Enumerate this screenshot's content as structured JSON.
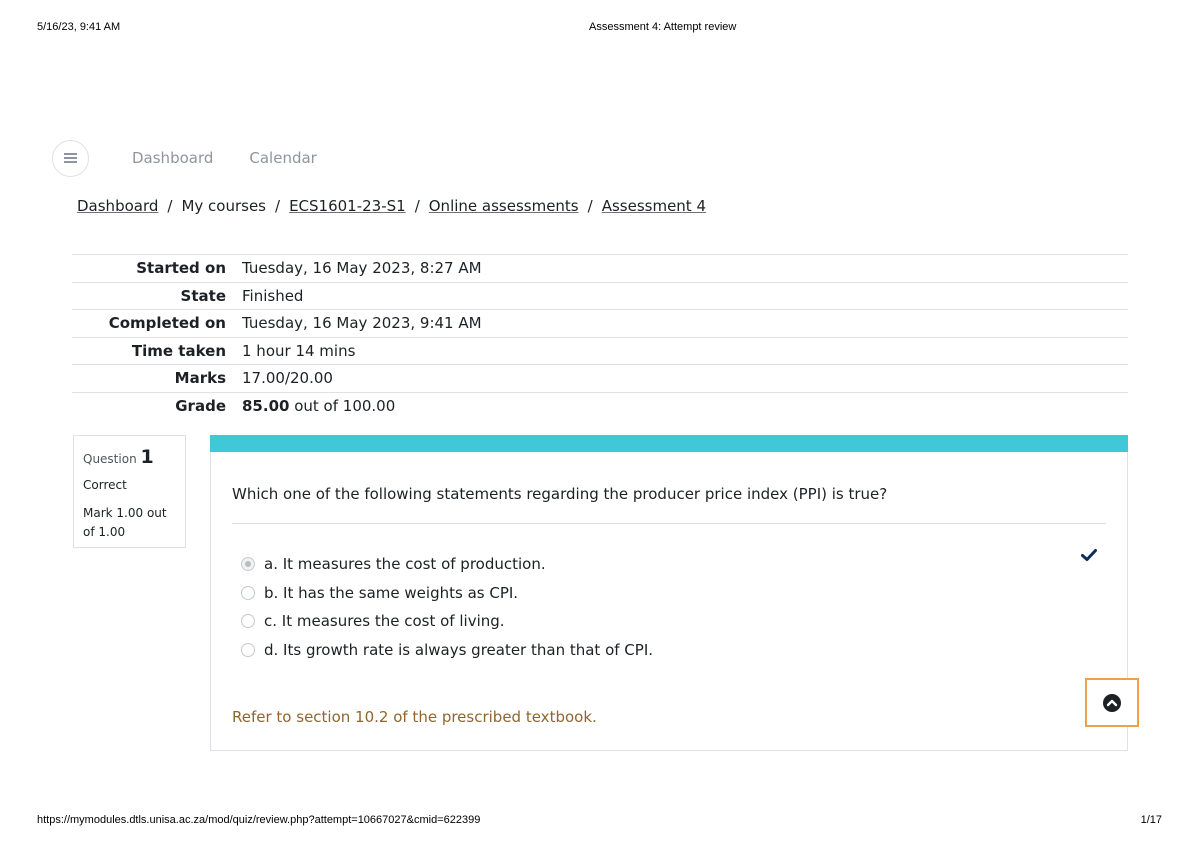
{
  "print_header": {
    "datetime": "5/16/23, 9:41 AM",
    "page_title": "Assessment 4: Attempt review"
  },
  "print_footer": {
    "url": "https://mymodules.dtls.unisa.ac.za/mod/quiz/review.php?attempt=10667027&cmid=622399",
    "page": "1/17"
  },
  "nav": {
    "menu_icon": "hamburger-menu-icon",
    "links": [
      "Dashboard",
      "Calendar"
    ]
  },
  "breadcrumb": {
    "items": [
      "Dashboard",
      "My courses",
      "ECS1601-23-S1",
      "Online assessments",
      "Assessment 4"
    ],
    "separator": "/"
  },
  "summary": {
    "rows": [
      {
        "label": "Started on",
        "value": "Tuesday, 16 May 2023, 8:27 AM"
      },
      {
        "label": "State",
        "value": "Finished"
      },
      {
        "label": "Completed on",
        "value": "Tuesday, 16 May 2023, 9:41 AM"
      },
      {
        "label": "Time taken",
        "value": "1 hour 14 mins"
      },
      {
        "label": "Marks",
        "value": "17.00/20.00"
      },
      {
        "label": "Grade",
        "value_bold": "85.00",
        "value_rest": " out of 100.00"
      }
    ]
  },
  "question": {
    "label": "Question",
    "number": "1",
    "state": "Correct",
    "mark": "Mark 1.00 out of 1.00",
    "text": "Which one of the following statements regarding the producer price index (PPI) is true?",
    "answers": [
      {
        "text": "a. It measures the cost of production.",
        "selected": true,
        "correct": true
      },
      {
        "text": "b. It has the same weights as CPI.",
        "selected": false
      },
      {
        "text": "c. It measures the cost of living.",
        "selected": false
      },
      {
        "text": "d. Its growth rate is always greater than that of CPI.",
        "selected": false
      }
    ],
    "feedback": "Refer to section 10.2 of the prescribed textbook.",
    "correct_icon": "checkmark-icon"
  },
  "colors": {
    "accent_bar": "#41c8d8",
    "feedback": "#8e662e",
    "check": "#0f2d5c",
    "focus_outline": "#f0a04b"
  }
}
